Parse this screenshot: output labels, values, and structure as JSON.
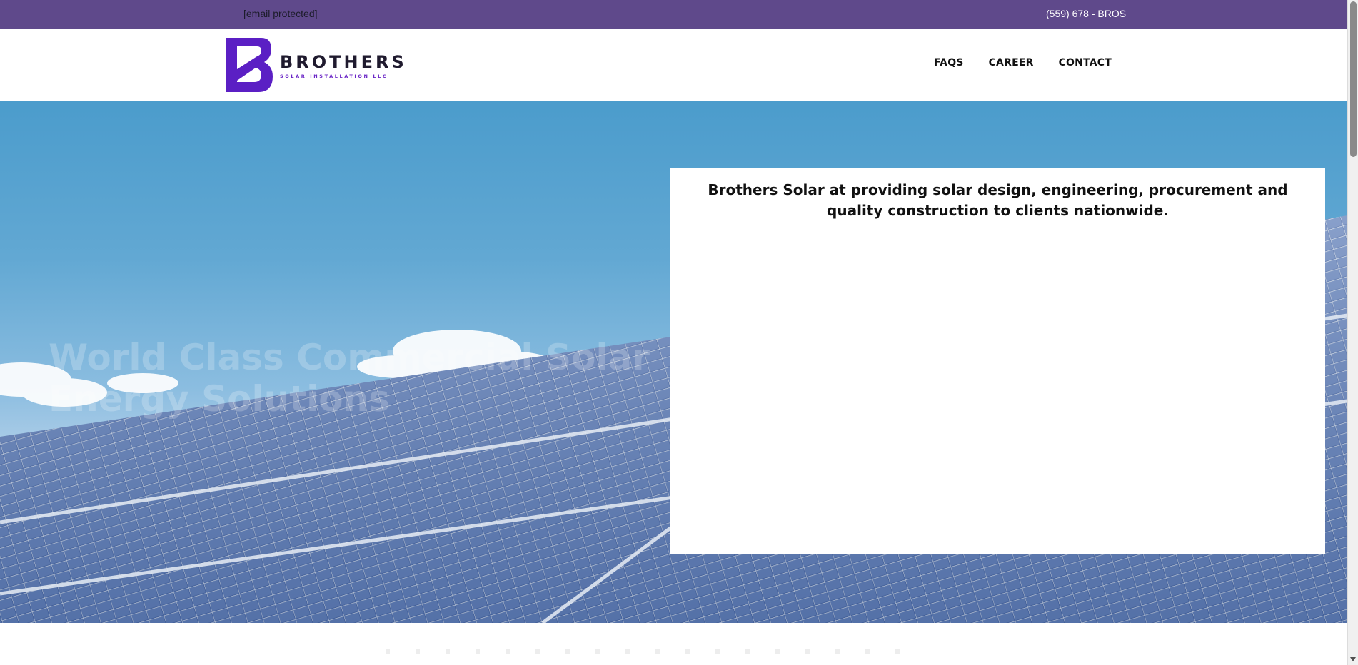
{
  "topbar": {
    "email": "[email protected]",
    "phone": "(559) 678 - BROS",
    "background_color": "#5f498b"
  },
  "header": {
    "logo": {
      "wordmark": "BROTHERS",
      "tagline": "SOLAR INSTALLATION LLC",
      "icon": "b-logo-icon",
      "brand_color": "#6a25c6"
    },
    "nav": [
      {
        "label": "FAQS"
      },
      {
        "label": "CAREER"
      },
      {
        "label": "CONTACT"
      }
    ]
  },
  "hero": {
    "headline": "World Class Commercial Solar Energy Solutions",
    "callout_text": "Brothers Solar at providing solar design, engineering, procurement and quality construction to clients nationwide."
  }
}
